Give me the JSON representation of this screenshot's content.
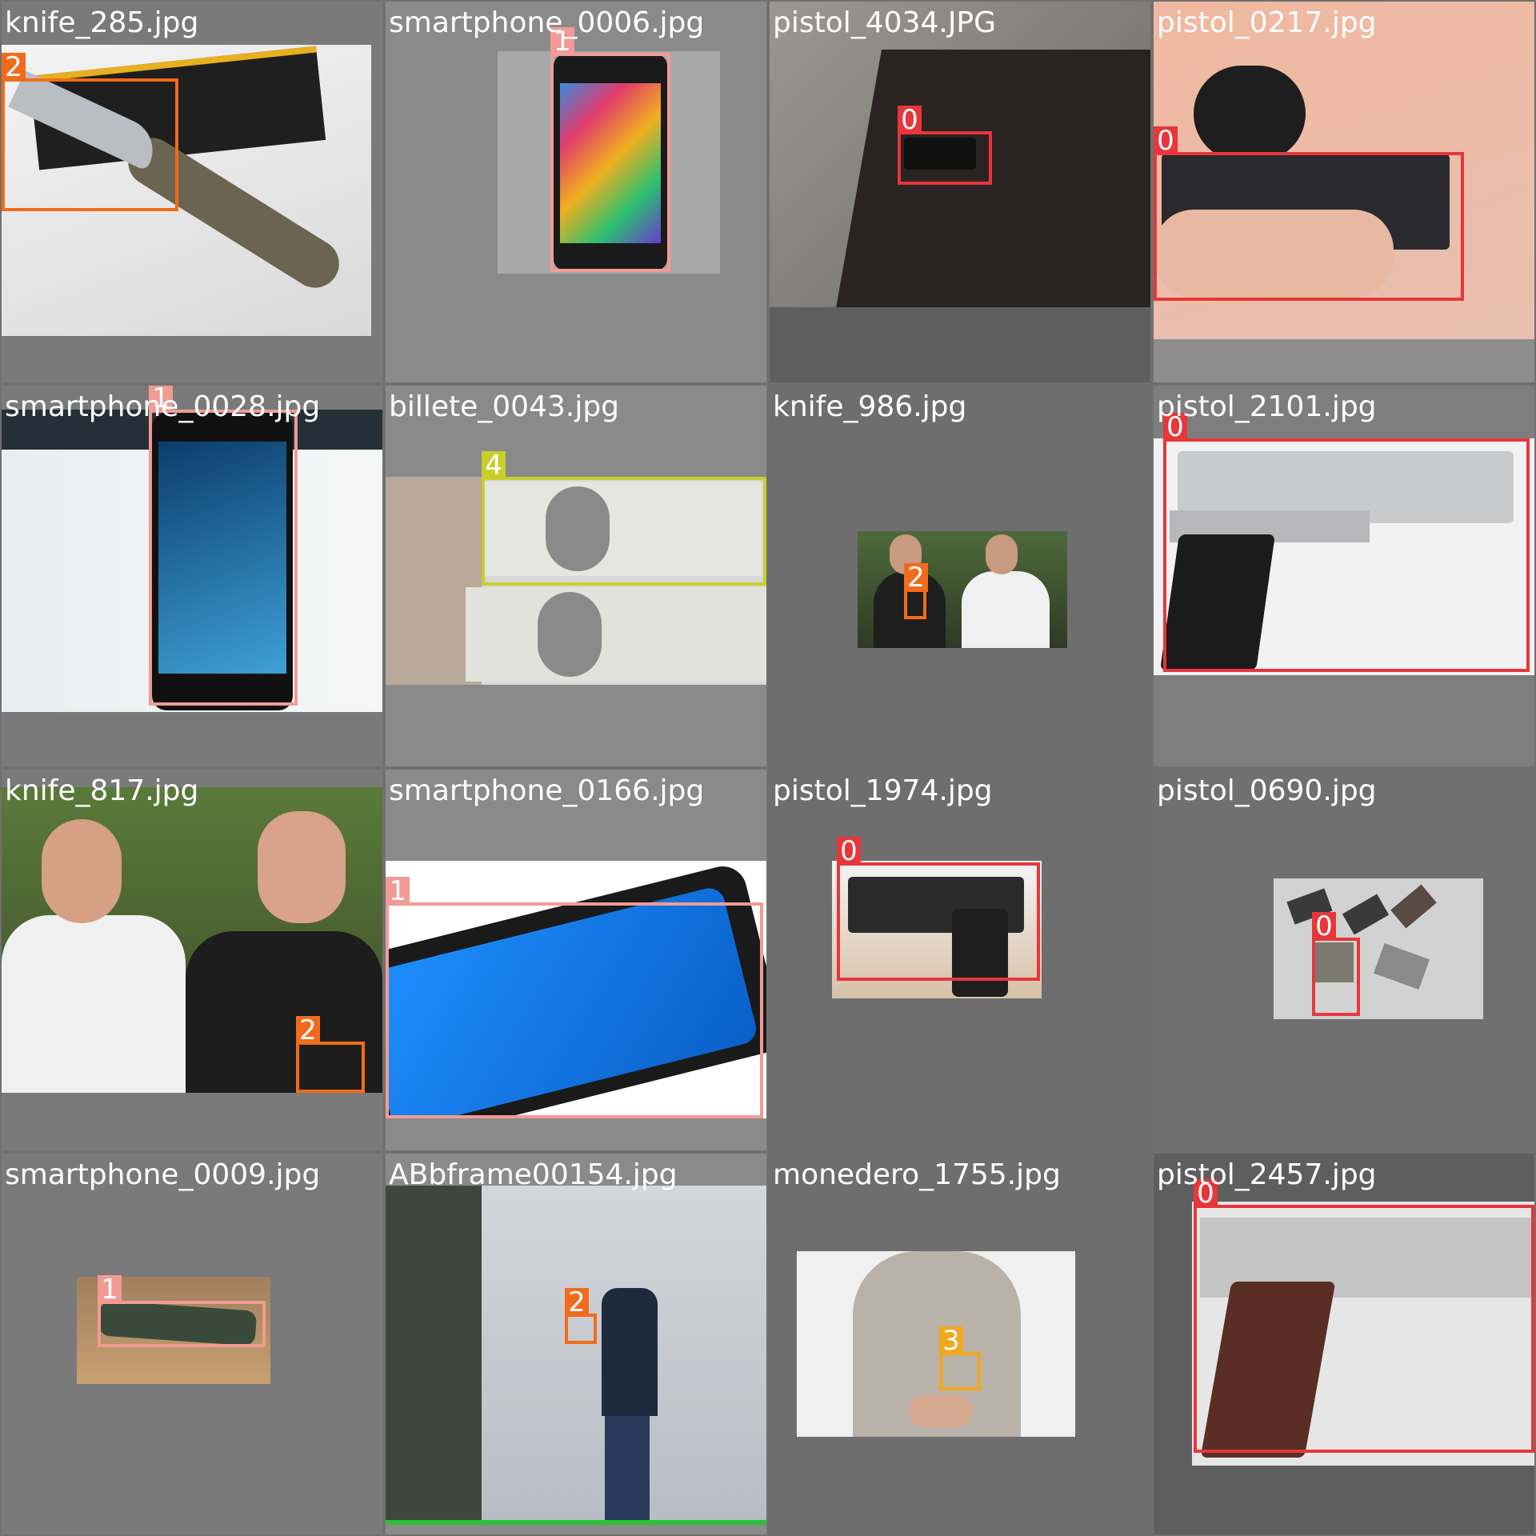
{
  "class_colors": {
    "0": "#e8363a",
    "1": "#f29b94",
    "2": "#f26b1c",
    "3": "#f2a81c",
    "4": "#c8cf2a"
  },
  "tiles": [
    {
      "file": "knife_285.jpg",
      "labels": [
        "2"
      ]
    },
    {
      "file": "smartphone_0006.jpg",
      "labels": [
        "1"
      ]
    },
    {
      "file": "pistol_4034.JPG",
      "labels": [
        "0"
      ]
    },
    {
      "file": "pistol_0217.jpg",
      "labels": [
        "0"
      ]
    },
    {
      "file": "smartphone_0028.jpg",
      "labels": [
        "1"
      ]
    },
    {
      "file": "billete_0043.jpg",
      "labels": [
        "4"
      ]
    },
    {
      "file": "knife_986.jpg",
      "labels": [
        "2"
      ]
    },
    {
      "file": "pistol_2101.jpg",
      "labels": [
        "0"
      ]
    },
    {
      "file": "knife_817.jpg",
      "labels": [
        "2"
      ]
    },
    {
      "file": "smartphone_0166.jpg",
      "labels": [
        "1"
      ]
    },
    {
      "file": "pistol_1974.jpg",
      "labels": [
        "0"
      ]
    },
    {
      "file": "pistol_0690.jpg",
      "labels": [
        "0"
      ]
    },
    {
      "file": "smartphone_0009.jpg",
      "labels": [
        "1"
      ]
    },
    {
      "file": "ABbframe00154.jpg",
      "labels": [
        "2"
      ]
    },
    {
      "file": "monedero_1755.jpg",
      "labels": [
        "3"
      ]
    },
    {
      "file": "pistol_2457.jpg",
      "labels": [
        "0"
      ]
    }
  ]
}
